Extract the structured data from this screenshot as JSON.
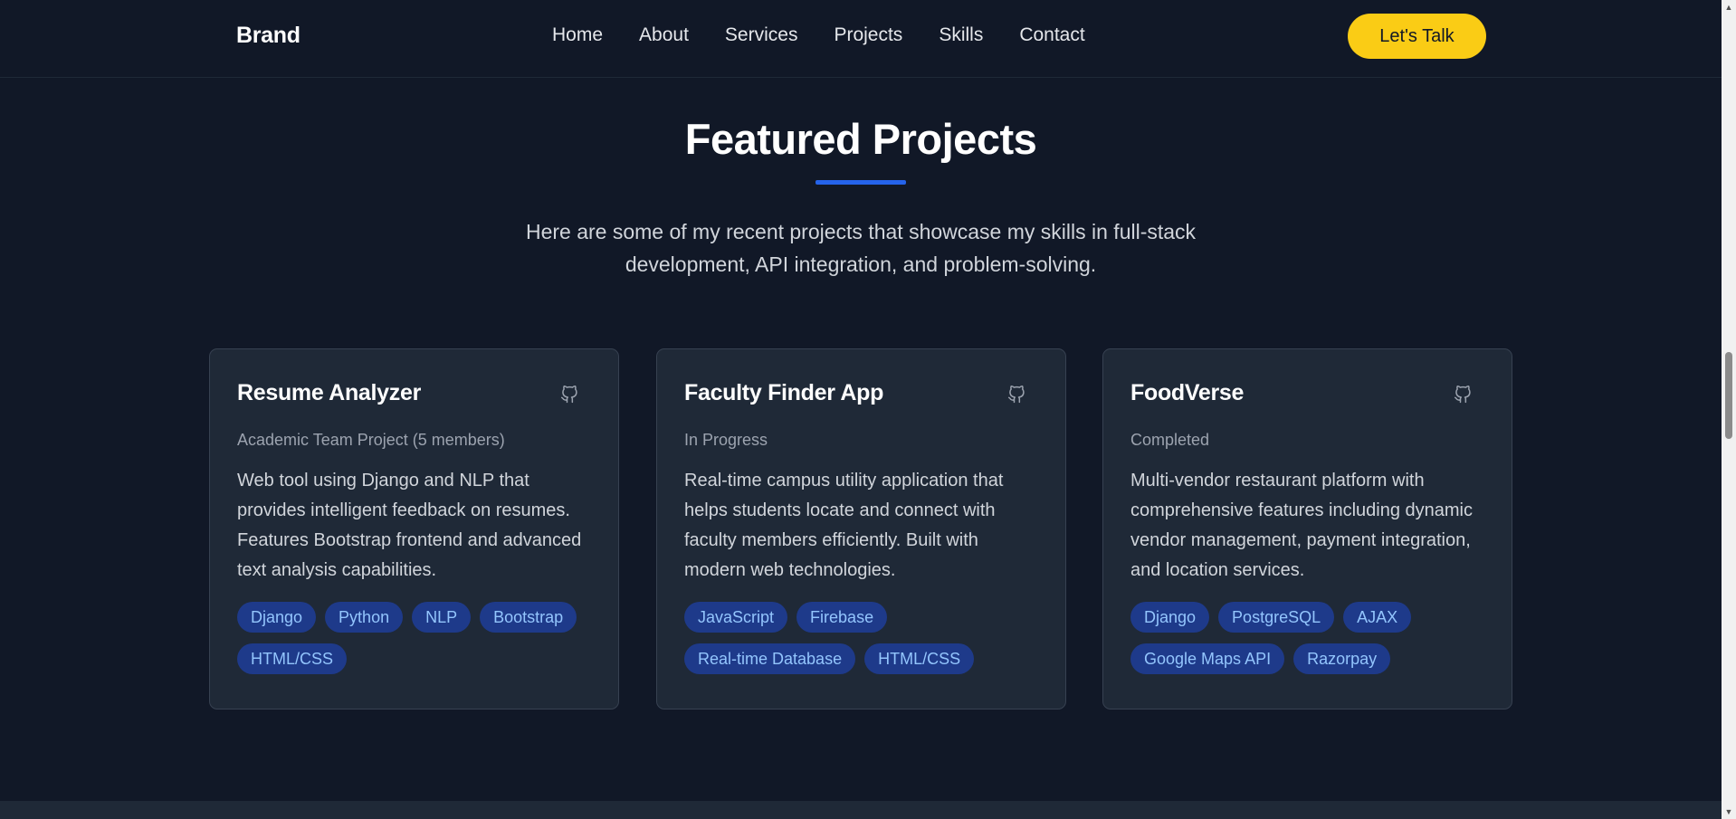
{
  "nav": {
    "brand": "Brand",
    "links": [
      "Home",
      "About",
      "Services",
      "Projects",
      "Skills",
      "Contact"
    ],
    "cta": "Let's Talk"
  },
  "section": {
    "title": "Featured Projects",
    "subtitle": "Here are some of my recent projects that showcase my skills in full-stack development, API integration, and problem-solving."
  },
  "projects": [
    {
      "title": "Resume Analyzer",
      "status": "Academic Team Project (5 members)",
      "description": "Web tool using Django and NLP that provides intelligent feedback on resumes. Features Bootstrap frontend and advanced text analysis capabilities.",
      "tags": [
        "Django",
        "Python",
        "NLP",
        "Bootstrap",
        "HTML/CSS"
      ],
      "icon": "github-icon"
    },
    {
      "title": "Faculty Finder App",
      "status": "In Progress",
      "description": "Real-time campus utility application that helps students locate and connect with faculty members efficiently. Built with modern web technologies.",
      "tags": [
        "JavaScript",
        "Firebase",
        "Real-time Database",
        "HTML/CSS"
      ],
      "icon": "github-icon"
    },
    {
      "title": "FoodVerse",
      "status": "Completed",
      "description": "Multi-vendor restaurant platform with comprehensive features including dynamic vendor management, payment integration, and location services.",
      "tags": [
        "Django",
        "PostgreSQL",
        "AJAX",
        "Google Maps API",
        "Razorpay"
      ],
      "icon": "github-icon"
    }
  ],
  "colors": {
    "background": "#111827",
    "card": "#1f2937",
    "accent": "#2563eb",
    "cta": "#facc15",
    "tag_bg": "#1e3a8a",
    "tag_text": "#93c5fd"
  }
}
